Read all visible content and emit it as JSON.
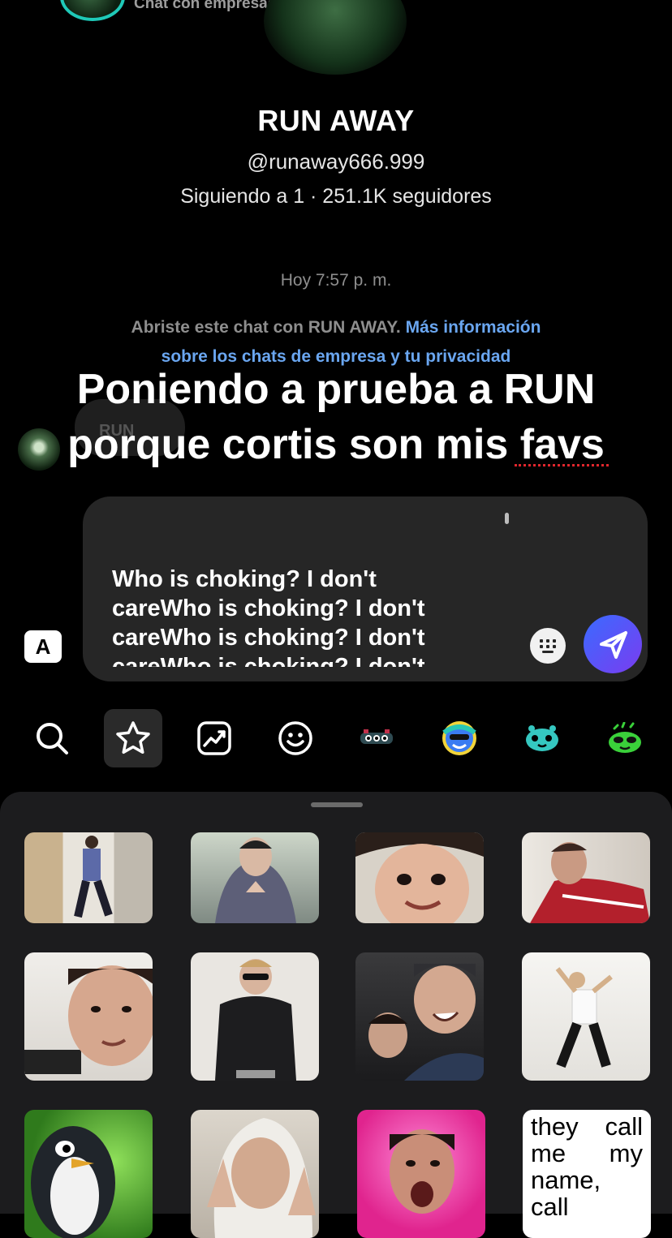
{
  "header": {
    "subtitle": "Chat con empresas"
  },
  "profile": {
    "name": "RUN AWAY",
    "handle": "@runaway666.999",
    "stats": "Siguiendo a 1 · 251.1K seguidores"
  },
  "chat": {
    "timestamp": "Hoy 7:57 p. m.",
    "info_prefix": "Abriste este chat con RUN AWAY. ",
    "info_link_1": "Más información",
    "info_link_2": "sobre los chats de empresa y tu privacidad",
    "ghost_message": "RUN"
  },
  "overlay": {
    "line1": "Poniendo a prueba a RUN",
    "line2": "porque cortis son mis favs"
  },
  "composer": {
    "text": "Who is choking? I don't\ncareWho is choking? I don't\ncareWho is choking? I don't\ncareWho is choking? I don't",
    "keyboard_label": "A"
  },
  "sticker_tabs": [
    {
      "name": "search-icon"
    },
    {
      "name": "star-icon",
      "selected": true
    },
    {
      "name": "trending-icon"
    },
    {
      "name": "smiley-icon"
    },
    {
      "name": "sticker-pack-1-icon"
    },
    {
      "name": "sticker-pack-2-icon"
    },
    {
      "name": "sticker-pack-3-icon"
    },
    {
      "name": "sticker-pack-4-icon"
    }
  ],
  "stickers": [
    {
      "name": "sticker-dancer-hallway"
    },
    {
      "name": "sticker-hoodie-clap"
    },
    {
      "name": "sticker-smiling-face-closeup"
    },
    {
      "name": "sticker-red-tracksuit"
    },
    {
      "name": "sticker-face-piano-room"
    },
    {
      "name": "sticker-sunglasses-leather"
    },
    {
      "name": "sticker-two-guys-laughing"
    },
    {
      "name": "sticker-dancing-white-shirt"
    },
    {
      "name": "sticker-penguin"
    },
    {
      "name": "sticker-white-hood-hands"
    },
    {
      "name": "sticker-pink-scream"
    },
    {
      "name": "sticker-text-they-call-me",
      "text": "they call me my name, call"
    }
  ]
}
